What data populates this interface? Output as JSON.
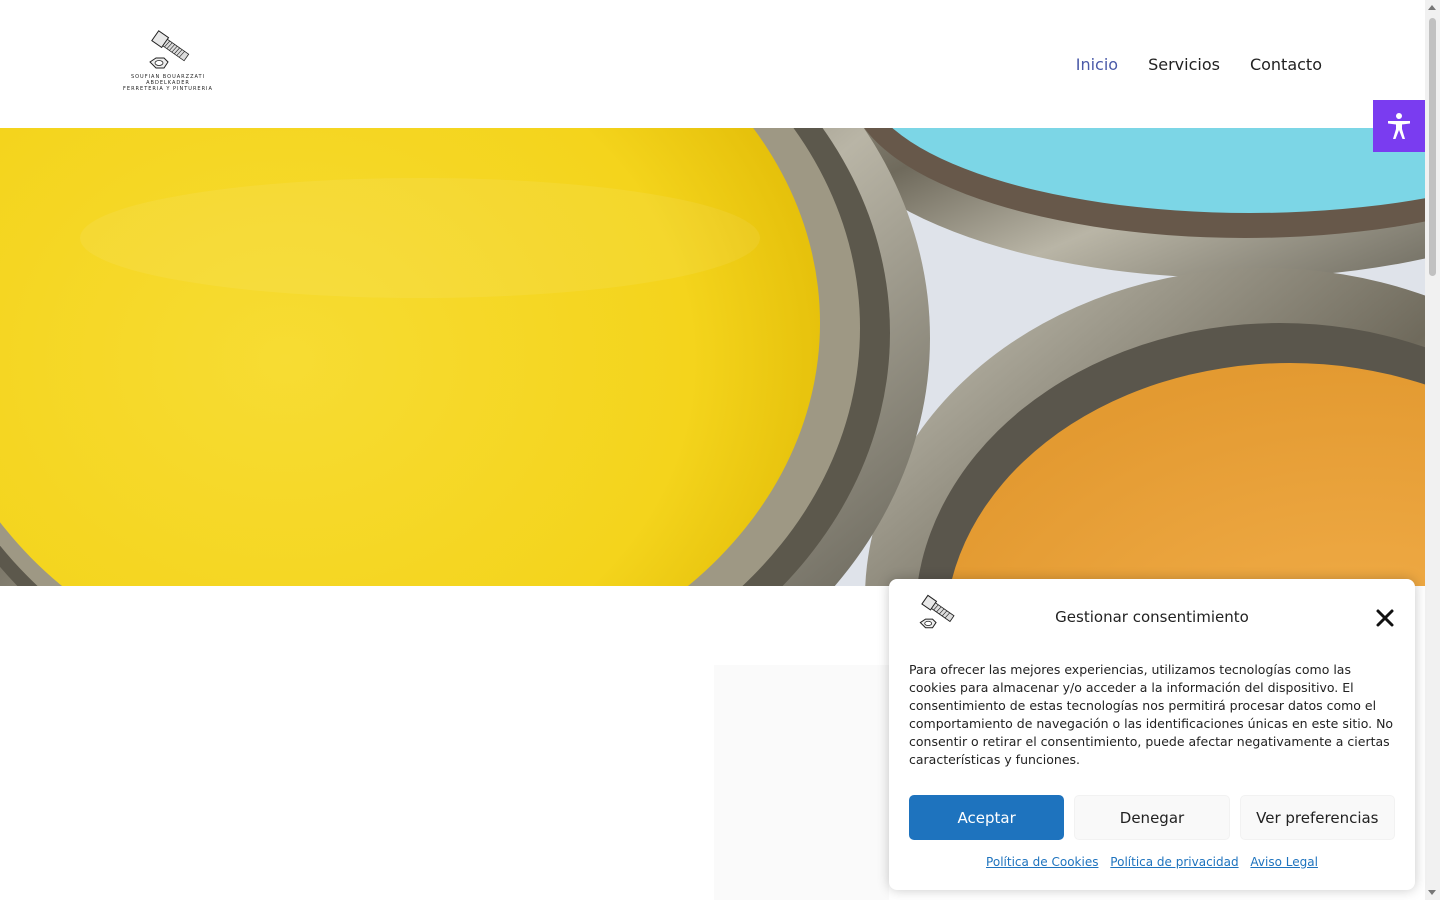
{
  "header": {
    "logo": {
      "line1": "SOUFIAN BOUARZZATI",
      "line2": "ABDELKADER",
      "line3": "FERRETERIA Y PINTURERIA",
      "icon": "bolt-and-nut-icon"
    },
    "nav": [
      {
        "label": "Inicio",
        "active": true
      },
      {
        "label": "Servicios",
        "active": false
      },
      {
        "label": "Contacto",
        "active": false
      }
    ]
  },
  "hero": {
    "image": "paint-cans-photo",
    "colors": {
      "yellow": "#f5d21a",
      "cyan": "#7bd7e6",
      "orange": "#f1ad4b",
      "metal": "#8a8576"
    }
  },
  "accessibility": {
    "icon": "accessibility-person-icon",
    "color": "#7a3cf0"
  },
  "consent": {
    "title": "Gestionar consentimiento",
    "body": "Para ofrecer las mejores experiencias, utilizamos tecnologías como las cookies para almacenar y/o acceder a la información del dispositivo. El consentimiento de estas tecnologías nos permitirá procesar datos como el comportamiento de navegación o las identificaciones únicas en este sitio. No consentir o retirar el consentimiento, puede afectar negativamente a ciertas características y funciones.",
    "buttons": {
      "accept": "Aceptar",
      "deny": "Denegar",
      "preferences": "Ver preferencias"
    },
    "links": {
      "cookies": "Política de Cookies",
      "privacy": "Política de privacidad",
      "legal": "Aviso Legal"
    },
    "accent": "#1e73be"
  }
}
